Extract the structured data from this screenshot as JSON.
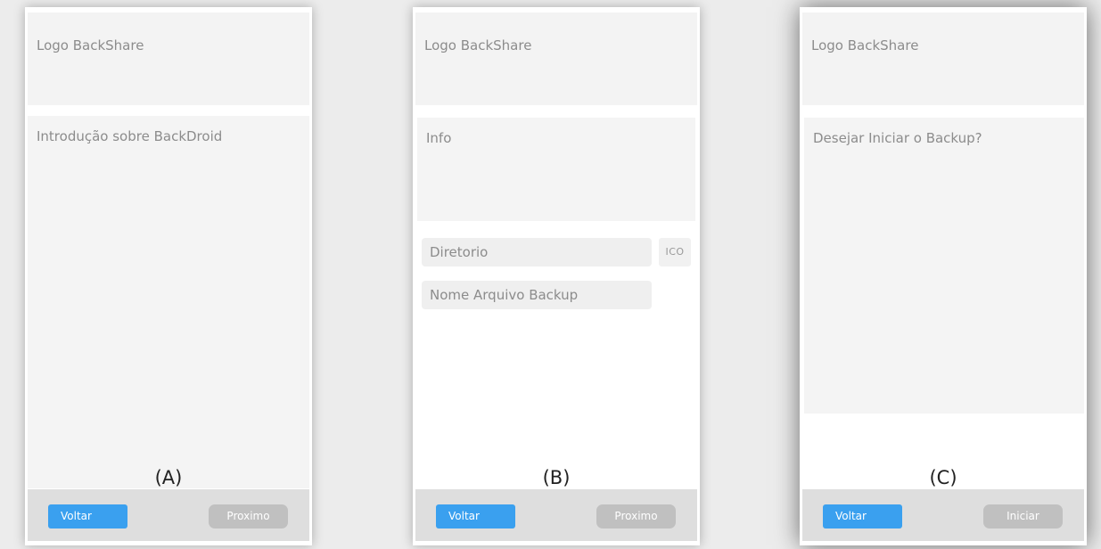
{
  "screens": [
    {
      "logo": "Logo BackShare",
      "content": "Introdução sobre BackDroid",
      "tag": "(A)",
      "back_button": "Voltar",
      "next_button": "Proximo"
    },
    {
      "logo": "Logo BackShare",
      "content": "Info",
      "fields": {
        "directory": "Diretorio",
        "icon_button": "ICO",
        "backup_name": "Nome Arquivo Backup"
      },
      "tag": "(B)",
      "back_button": "Voltar",
      "next_button": "Proximo"
    },
    {
      "logo": "Logo BackShare",
      "content": "Desejar Iniciar o Backup?",
      "tag": "(C)",
      "back_button": "Voltar",
      "next_button": "Iniciar"
    }
  ],
  "colors": {
    "primary_button": "#3aa0ef",
    "secondary_button": "#c0c0c0",
    "panel": "#f3f3f3",
    "bottom_bar": "#dedede"
  }
}
